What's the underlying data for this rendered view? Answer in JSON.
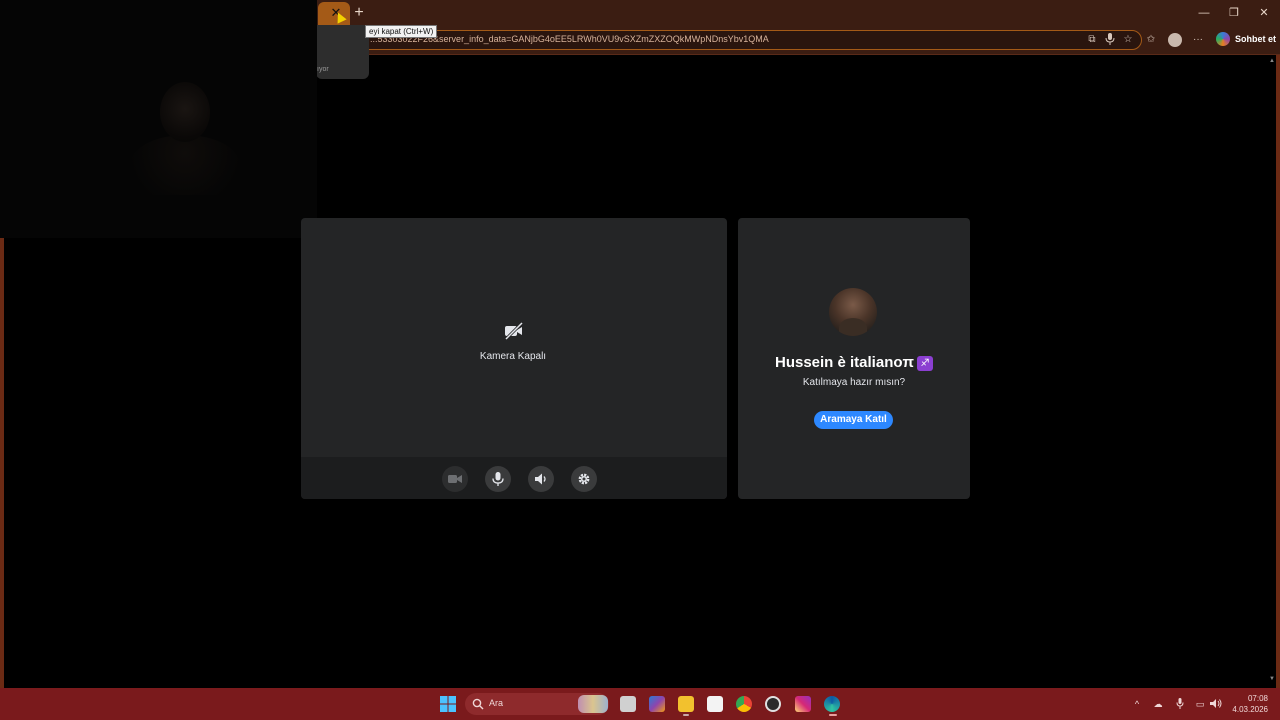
{
  "browser": {
    "tooltip": "eyi kapat (Ctrl+W)",
    "tab_preview_text": "ıyor",
    "url": "...53303022F26&server_info_data=GANjbG4oEE5LRWh0VU9vSXZmZXZOQkMWpNDnsYbv1QMA",
    "copilot_label": "Sohbet et",
    "close_tab_glyph": "✕",
    "new_tab_glyph": "+",
    "window_controls": [
      "—",
      "❐",
      "✕"
    ]
  },
  "call_preview": {
    "camera_off_label": "Kamera Kapalı",
    "controls": [
      {
        "name": "camera-toggle",
        "icon": "video-icon",
        "enabled": false
      },
      {
        "name": "microphone-toggle",
        "icon": "microphone-icon",
        "enabled": true
      },
      {
        "name": "speaker-toggle",
        "icon": "speaker-icon",
        "enabled": true
      },
      {
        "name": "settings",
        "icon": "gear-icon",
        "enabled": true
      }
    ]
  },
  "join": {
    "caller_name": "Hussein è italianoπ",
    "caller_emoji": "♐",
    "prompt": "Katılmaya hazır mısın?",
    "join_button": "Aramaya Katıl",
    "accent_color": "#2d88ff"
  },
  "taskbar": {
    "search_placeholder": "Ara",
    "time": "07:08",
    "date": "4.03.2026",
    "color": "#7a1a1c"
  }
}
